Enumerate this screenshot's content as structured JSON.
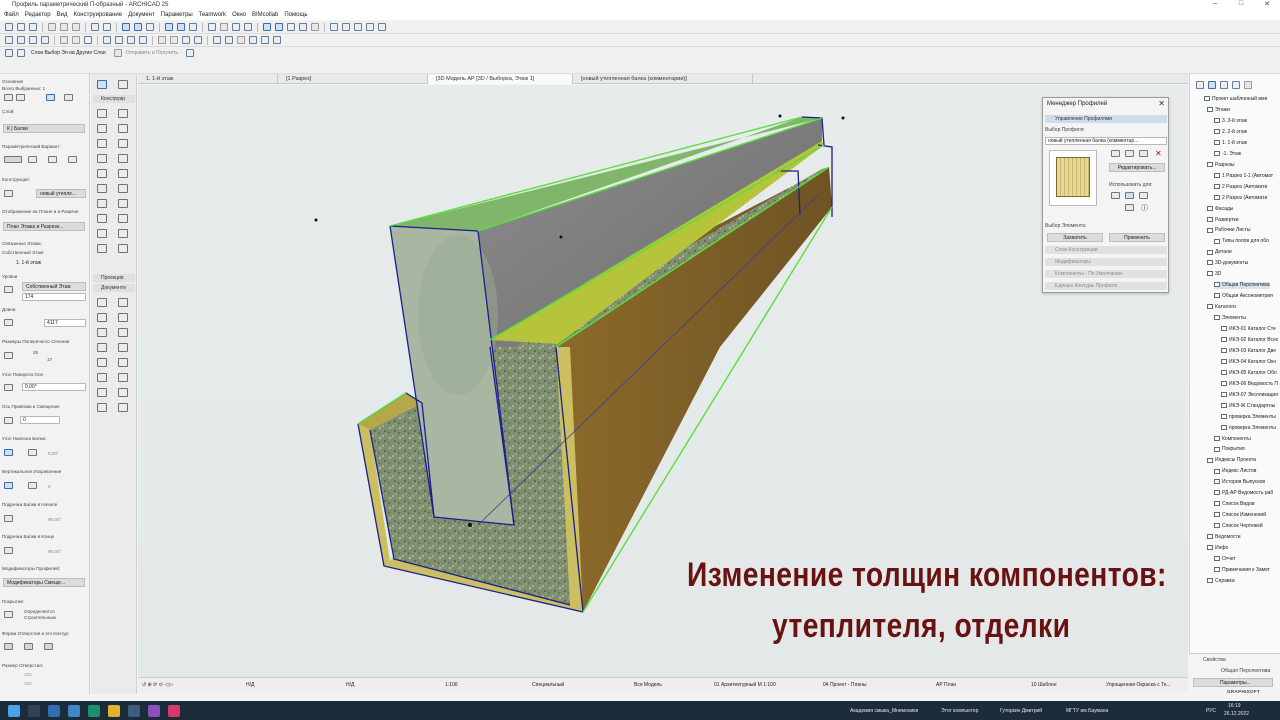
{
  "window": {
    "title": "Профиль параметрический П-образный - ARCHICAD 25"
  },
  "menu": [
    "Файл",
    "Редактор",
    "Вид",
    "Конструирование",
    "Документ",
    "Параметры",
    "Teamwork",
    "Окно",
    "BIMcollab",
    "Помощь"
  ],
  "toolbar3": {
    "layer_combo": "Слои Выбор Эл-ов Другие Слои",
    "send_receive": "Отправить и Получить"
  },
  "tabs": [
    {
      "label": "1. 1-й этаж"
    },
    {
      "label": "[1 Разрез]"
    },
    {
      "label": "[3D Модель АР [3D / Выборка, Этаж 1]"
    },
    {
      "label": "[новый утепленная балка (комментарии)]"
    }
  ],
  "infobox": {
    "main": "Основная",
    "selected": "Всего Выбранных: 1",
    "layer_label": "Слой:",
    "layer_value": "К | Балки",
    "param_variant": "Параметрический Вариант:",
    "construction": "Конструкция:",
    "construction_value": "новый утепле...",
    "display_plan": "Отображение на Плане и в Разрезе",
    "display_value": "План Этажа и Разрезе...",
    "linked_floors": "Связанные Этажи:",
    "own_floor": "Собственный Этаж:",
    "floor_value": "1. 1-й этаж",
    "levels": "Уровни",
    "own_floor2": "Собственный Этаж",
    "level_value": "174",
    "length": "Длина",
    "length_value": "4117",
    "cross_size": "Размеры Поперечного Сечения",
    "cross_a": "25",
    "cross_b": "17",
    "rot_angle": "Угол Поворота Оси",
    "rot_value": "0,00°",
    "offset": "Ось Привязки и Смещение",
    "offset_value": "0",
    "slope": "Угол Наклона Балки:",
    "slope_value": "0,00°",
    "vertical": "Вертикальное Искривление",
    "vertical_value": "0",
    "start_cut": "Подрезка Балки в Начале",
    "start_value": "90,00°",
    "end_cut": "Подрезка Балки в Конце",
    "end_value": "90,00°",
    "modifiers": "Модификаторы Профилей:",
    "modifiers_value": "Модификаторы Смеще...",
    "covering": "Покрытие:",
    "covering_value": "Определяется Строительным",
    "opening_shape": "Форма Отверстия и его Контур:",
    "opening_size": "Размер Отверстия:",
    "opening_w": "100",
    "opening_h": "100"
  },
  "toolbox": {
    "design": "Конструир",
    "view": "Проекция",
    "docs": "Документи"
  },
  "overlay": {
    "line1": "Изменение толщин компонентов:",
    "line2": "утеплителя, отделки"
  },
  "profile_manager": {
    "title": "Менеджер Профилей",
    "section_manage": "Управление Профилями",
    "select_profile": "Выбор Профиля:",
    "profile_value": "новый утепленная балка (комментар...",
    "edit_button": "Редактировать...",
    "use_for": "Использовать для:",
    "select_elements": "Выбор Элемента:",
    "capture_button": "Захватить",
    "apply_button": "Применить",
    "sections": [
      "Слои Конструкции",
      "Модификаторы",
      "Компоненты - По Умолчанию",
      "Единые Контуры Профиля"
    ]
  },
  "navigator": {
    "root": "Проект шаблонный имя",
    "items": [
      {
        "label": "Этажи",
        "lvl": 1
      },
      {
        "label": "3. 3-й этаж",
        "lvl": 2
      },
      {
        "label": "2. 2-й этаж",
        "lvl": 2
      },
      {
        "label": "1. 1-й этаж",
        "lvl": 2
      },
      {
        "label": "-1. Этаж",
        "lvl": 2
      },
      {
        "label": "Разрезы",
        "lvl": 1
      },
      {
        "label": "1 Разрез 1-1 (Автомат",
        "lvl": 2
      },
      {
        "label": "2 Разрез (Автомати",
        "lvl": 2
      },
      {
        "label": "2 Разрез (Автомати",
        "lvl": 2
      },
      {
        "label": "Фасады",
        "lvl": 1
      },
      {
        "label": "Развертки",
        "lvl": 1
      },
      {
        "label": "Рабочие Листы",
        "lvl": 1
      },
      {
        "label": "Типы полов для обо",
        "lvl": 2
      },
      {
        "label": "Детали",
        "lvl": 1
      },
      {
        "label": "3D-документы",
        "lvl": 1
      },
      {
        "label": "3D",
        "lvl": 1
      },
      {
        "label": "Общая Перспектива",
        "lvl": 2,
        "sel": true
      },
      {
        "label": "Общая Аксонометрия",
        "lvl": 2
      },
      {
        "label": "Каталоги",
        "lvl": 1
      },
      {
        "label": "Элементы",
        "lvl": 2
      },
      {
        "label": "ИКЭ-01 Каталог Сте",
        "lvl": 3
      },
      {
        "label": "ИКЭ-02 Каталог Всех",
        "lvl": 3
      },
      {
        "label": "ИКЭ-03 Каталог Две",
        "lvl": 3
      },
      {
        "label": "ИКЭ-04 Каталог Окн",
        "lvl": 3
      },
      {
        "label": "ИКЭ-05 Каталог Обл",
        "lvl": 3
      },
      {
        "label": "ИКЭ-06 Ведомость П",
        "lvl": 3
      },
      {
        "label": "ИКЭ-07 Экспликация",
        "lvl": 3
      },
      {
        "label": "ИКЭ-Ж Стандартны",
        "lvl": 3
      },
      {
        "label": "проверка Элементы",
        "lvl": 3
      },
      {
        "label": "проверка Элементы",
        "lvl": 3
      },
      {
        "label": "Компоненты",
        "lvl": 2
      },
      {
        "label": "Покрытия",
        "lvl": 2
      },
      {
        "label": "Индексы Проекта",
        "lvl": 1
      },
      {
        "label": "Индекс Листов",
        "lvl": 2
      },
      {
        "label": "История Выпусков",
        "lvl": 2
      },
      {
        "label": "РД-АР Ведомость раб",
        "lvl": 2
      },
      {
        "label": "Список Видов",
        "lvl": 2
      },
      {
        "label": "Список Изменений",
        "lvl": 2
      },
      {
        "label": "Список Чертежей",
        "lvl": 2
      },
      {
        "label": "Ведомости",
        "lvl": 1
      },
      {
        "label": "Инфо",
        "lvl": 1
      },
      {
        "label": "Отчет",
        "lvl": 2
      },
      {
        "label": "Примечания к Замет",
        "lvl": 2
      },
      {
        "label": "Справка",
        "lvl": 1
      }
    ],
    "props_title": "Свойства",
    "props_value": "Общая Перспектива",
    "params_button": "Параметры...",
    "graphisoft": "GRAPHISOFT"
  },
  "status": {
    "a": "Н/Д",
    "b": "Н/Д",
    "scale": "1:100",
    "special": "Специальный",
    "model": "Вся Модель",
    "layers": "01 Архитектурный М 1:100",
    "pen": "04 Проект - Планы",
    "ap": "АР План",
    "tmpl": "10 Шаблон",
    "render": "Упрощенная Окраска с Те..."
  },
  "taskbar": {
    "app1": "Академия смыка_Мнемоники",
    "app2": "Этот компьютер",
    "app3": "Гуторкин Дмитрий",
    "app4": "МГТУ им Баумана",
    "lang": "РУС",
    "time": "16:19",
    "date": "26.12.2022"
  },
  "colors": {
    "overlay_text": "#6a1212",
    "edge_green": "#55e23a",
    "edge_blue": "#1b1f8c"
  }
}
